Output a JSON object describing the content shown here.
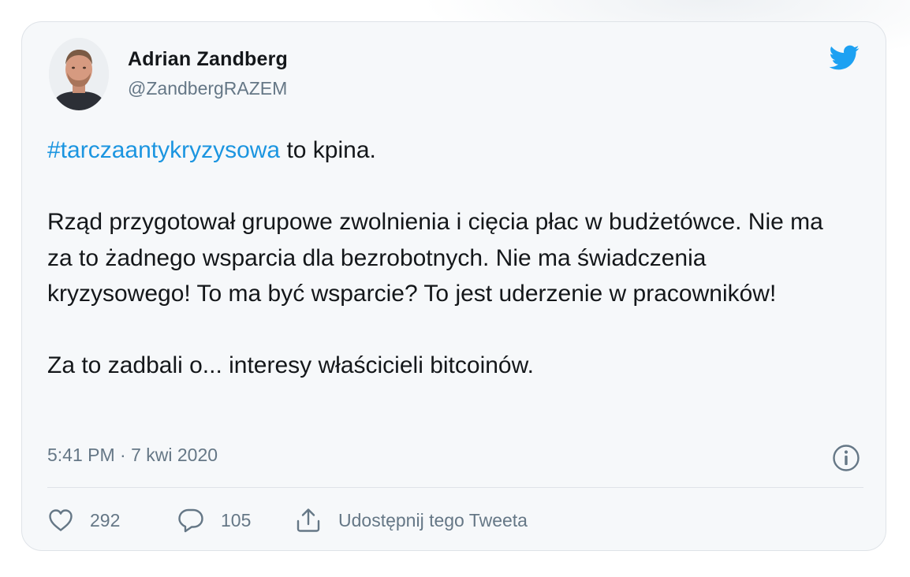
{
  "author": {
    "name": "Adrian Zandberg",
    "handle": "@ZandbergRAZEM",
    "avatar_icon": "person-avatar"
  },
  "brand": {
    "icon": "twitter-bird-icon",
    "color": "#1da1f2"
  },
  "tweet": {
    "hashtag": "#tarczaantykryzysowa",
    "hashtag_suffix": " to kpina.",
    "paragraph_2": "Rząd przygotował grupowe zwolnienia i cięcia płac w budżetówce. Nie ma za to żadnego wsparcia dla bezrobotnych. Nie ma świadczenia kryzysowego! To ma być wsparcie? To jest uderzenie w pracowników!",
    "paragraph_3": "Za to zadbali o... interesy właścicieli bitcoinów.",
    "link_color": "#1b95e0"
  },
  "meta": {
    "timestamp": "5:41 PM · 7 kwi 2020",
    "info_icon": "info-icon"
  },
  "actions": {
    "likes": "292",
    "replies": "105",
    "share_label": "Udostępnij tego Tweeta"
  }
}
